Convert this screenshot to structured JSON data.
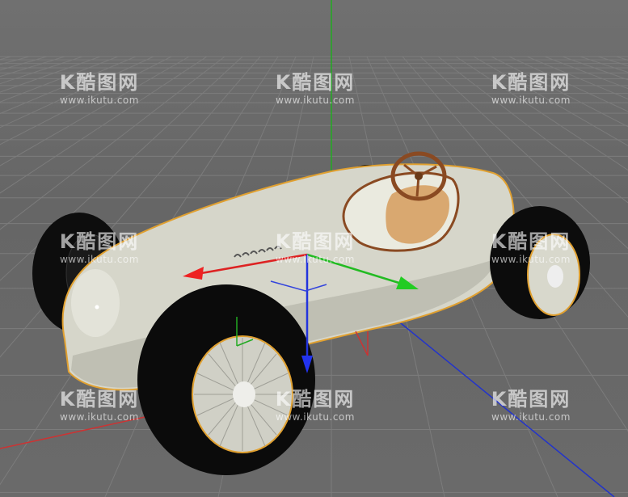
{
  "viewport": {
    "background": "#6b6b6b",
    "grid_color": "#7a7a7a",
    "axis_colors": {
      "x": "#cc2222",
      "y": "#22aa22",
      "z": "#2233cc"
    }
  },
  "model": {
    "body_color": "#d8d8cc",
    "tire_color": "#0c0c0c",
    "outline_color": "#e0a030",
    "seat_color": "#d9a870",
    "steering_wheel_color": "#8a4a22"
  },
  "watermarks": [
    {
      "brand": "K酷图网",
      "url": "www.ikutu.com"
    },
    {
      "brand": "K酷图网",
      "url": "www.ikutu.com"
    },
    {
      "brand": "K酷图网",
      "url": "www.ikutu.com"
    },
    {
      "brand": "K酷图网",
      "url": "www.ikutu.com"
    },
    {
      "brand": "K酷图网",
      "url": "www.ikutu.com"
    },
    {
      "brand": "K酷图网",
      "url": "www.ikutu.com"
    },
    {
      "brand": "K酷图网",
      "url": "www.ikutu.com"
    },
    {
      "brand": "K酷图网",
      "url": "www.ikutu.com"
    },
    {
      "brand": "K酷图网",
      "url": "www.ikutu.com"
    }
  ]
}
